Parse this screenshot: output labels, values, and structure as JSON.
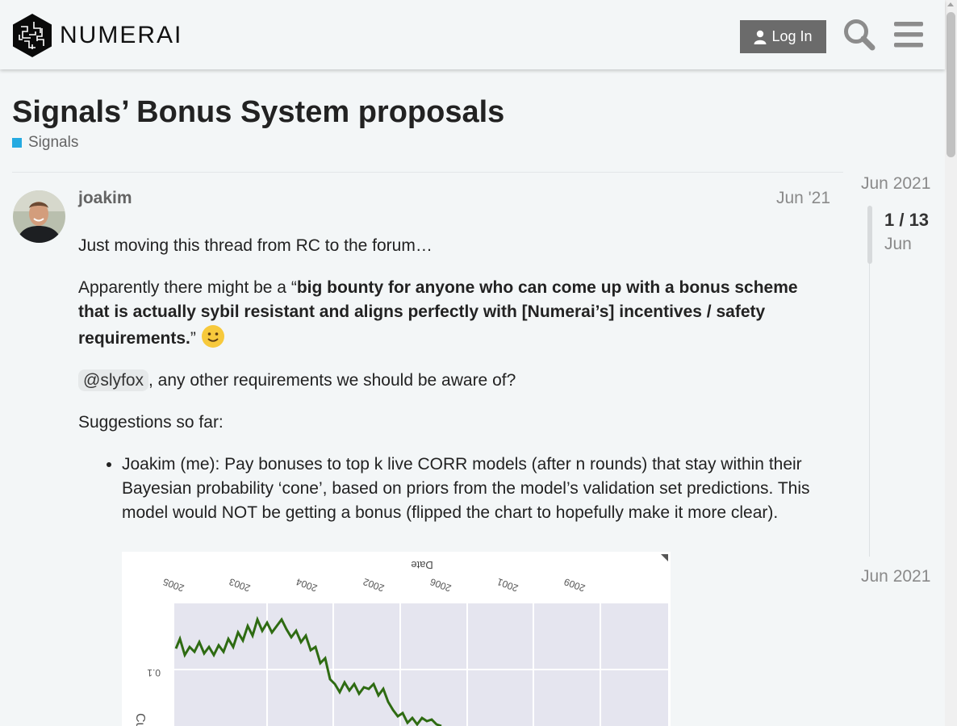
{
  "header": {
    "logo_text": "NUMERAI",
    "login_label": "Log In",
    "icons": [
      "search-icon",
      "hamburger-menu-icon",
      "user-icon"
    ]
  },
  "topic": {
    "title": "Signals’ Bonus System proposals",
    "category": "Signals",
    "category_color": "#25aae1"
  },
  "post": {
    "author": "joakim",
    "date": "Jun '21",
    "p1": "Just moving this thread from RC to the forum…",
    "p2_prefix": "Apparently there might be a “",
    "p2_bold": "big bounty for anyone who can come up with a bonus scheme that is actually sybil resistant and aligns perfectly with [Numerai’s] incentives / safety requirements.",
    "p2_suffix": "”",
    "mention": "@slyfox",
    "p3_rest": ", any other requirements we should be aware of?",
    "p4": "Suggestions so far:",
    "bullets": [
      "Joakim (me): Pay bonuses to top k live CORR models (after n rounds) that stay within their Bayesian probability ‘cone’, based on priors from the model’s validation set predictions. This model would NOT be getting a bonus (flipped the chart to hopefully make it more clear)."
    ],
    "image": {
      "title": "Date",
      "tick_labels": [
        "2005",
        "2003",
        "2004",
        "2002",
        "2006",
        "2001",
        "2009"
      ],
      "y_tick": "0.1",
      "y_label": "Cumu"
    }
  },
  "timeline": {
    "top_date": "Jun 2021",
    "position": "1 / 13",
    "current_month": "Jun",
    "bottom_date": "Jun 2021"
  }
}
